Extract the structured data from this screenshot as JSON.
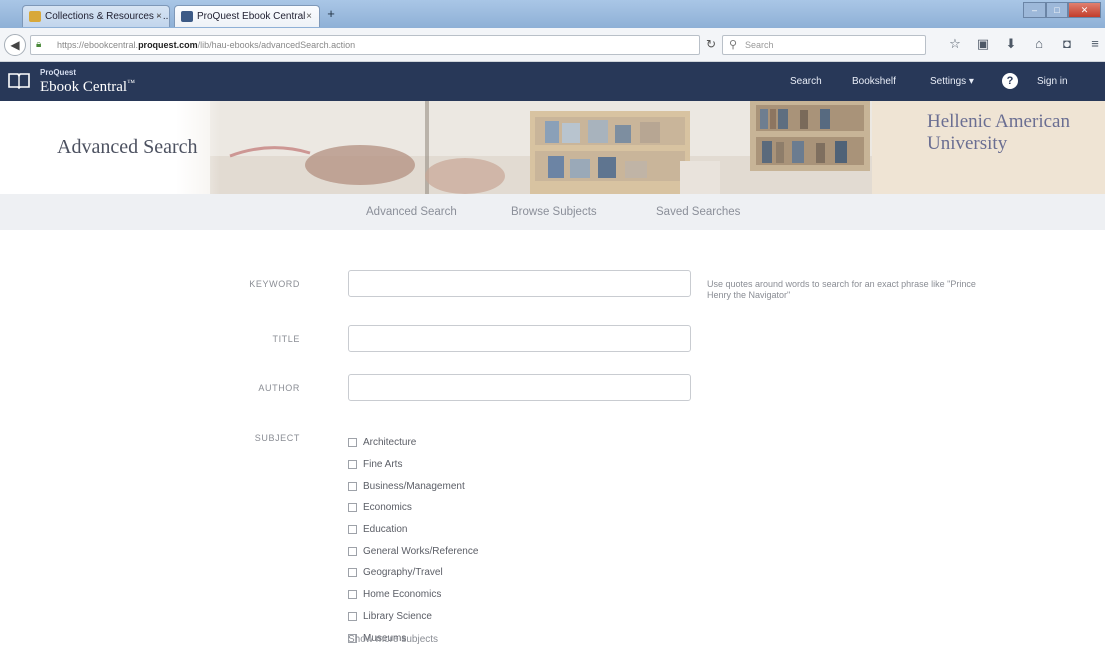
{
  "browser": {
    "tabs": [
      {
        "label": "Collections & Resources - ...",
        "active": false
      },
      {
        "label": "ProQuest Ebook Central",
        "active": true
      }
    ],
    "new_tab": "+",
    "url_prefix": "https://ebookcentral.",
    "url_domain": "proquest.com",
    "url_path": "/lib/hau-ebooks/advancedSearch.action",
    "search_placeholder": "Search"
  },
  "site": {
    "brand_small": "ProQuest",
    "brand_main": "Ebook Central",
    "brand_tm": "™",
    "nav": {
      "search": "Search",
      "bookshelf": "Bookshelf",
      "settings": "Settings ▾",
      "help": "?",
      "signin": "Sign in"
    }
  },
  "banner": {
    "title": "Advanced Search",
    "institution": "Hellenic American University"
  },
  "subnav": {
    "advanced": "Advanced Search",
    "browse": "Browse Subjects",
    "saved": "Saved Searches"
  },
  "form": {
    "keyword_label": "KEYWORD",
    "title_label": "TITLE",
    "author_label": "AUTHOR",
    "subject_label": "SUBJECT",
    "keyword_value": "",
    "title_value": "",
    "author_value": "",
    "keyword_hint": "Use quotes around words to search for an exact phrase like \"Prince Henry the Navigator\"",
    "subjects": [
      "Architecture",
      "Fine Arts",
      "Business/Management",
      "Economics",
      "Education",
      "General Works/Reference",
      "Geography/Travel",
      "Home Economics",
      "Library Science",
      "Museums"
    ],
    "show_more": "Show more subjects"
  },
  "colors": {
    "header_bg": "#283858",
    "subnav_bg": "#eef0f3",
    "institution_text": "#6a6e92"
  }
}
